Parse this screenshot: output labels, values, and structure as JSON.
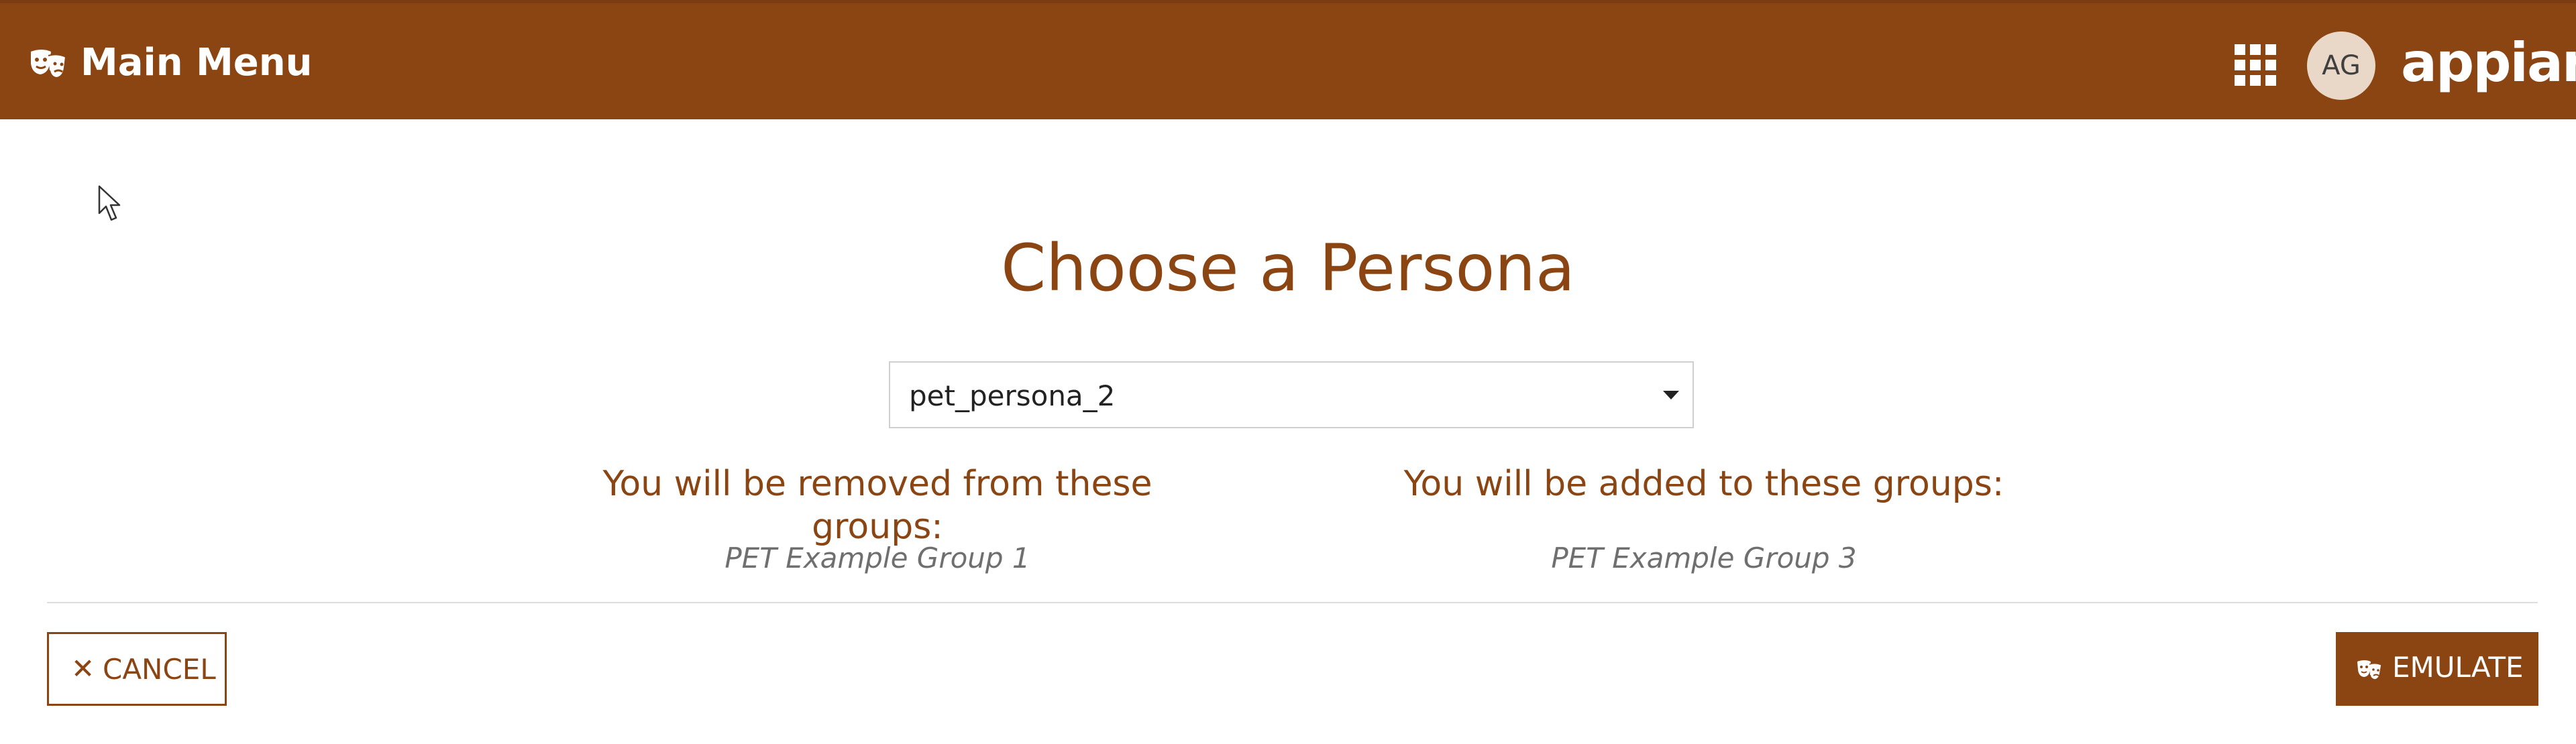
{
  "header": {
    "title": "Main Menu",
    "menu_icon": "theater-masks-icon",
    "apps_icon": "grid-apps-icon",
    "avatar_initials": "AG",
    "brand": "appian",
    "background_color": "#8b4513"
  },
  "main": {
    "title": "Choose a Persona",
    "persona_select": {
      "value": "pet_persona_2",
      "icon": "caret-down-icon"
    },
    "removed_groups": {
      "heading": "You will be removed from these groups:",
      "items": [
        "PET Example Group 1"
      ]
    },
    "added_groups": {
      "heading": "You will be added to these groups:",
      "items": [
        "PET Example Group 3"
      ]
    }
  },
  "footer": {
    "cancel": {
      "label": "CANCEL",
      "icon": "close-icon"
    },
    "emulate": {
      "label": "EMULATE",
      "icon": "theater-masks-icon"
    }
  },
  "colors": {
    "accent": "#8b4513",
    "muted_text": "#6f6f6f",
    "divider": "#dddddd"
  }
}
